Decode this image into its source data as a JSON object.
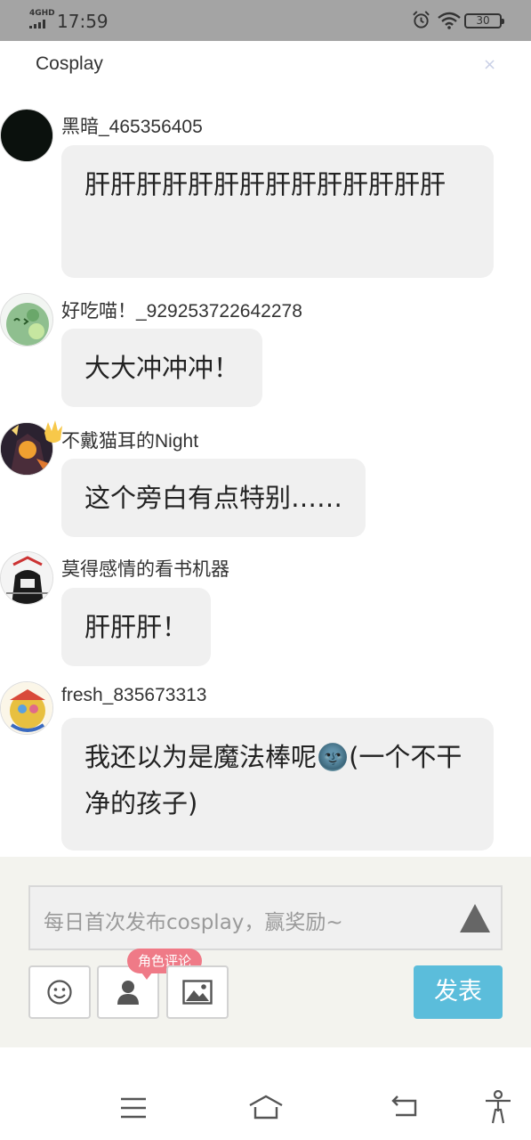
{
  "status_bar": {
    "network": "4GHD",
    "time": "17:59",
    "battery": "30"
  },
  "header": {
    "title": "Cosplay",
    "close_label": "×"
  },
  "comments": [
    {
      "username": "黑暗_465356405",
      "text": "肝肝肝肝肝肝肝肝肝肝肝肝肝肝"
    },
    {
      "username": "好吃喵！_929253722642278",
      "text": "大大冲冲冲！"
    },
    {
      "username": "不戴猫耳的Night",
      "text": "这个旁白有点特别……"
    },
    {
      "username": "莫得感情的看书机器",
      "text": "肝肝肝！"
    },
    {
      "username": "fresh_835673313",
      "text": "我还以为是魔法棒呢🌚(一个不干净的孩子)"
    }
  ],
  "composer": {
    "placeholder": "每日首次发布cosplay，赢奖励~",
    "role_badge": "角色评论",
    "publish_label": "发表",
    "accent": "#5bbddb",
    "badge_color": "#ef7a87"
  },
  "icons": {
    "emoji": "smiley-icon",
    "role": "person-icon",
    "image": "image-icon",
    "send": "triangle-icon"
  }
}
